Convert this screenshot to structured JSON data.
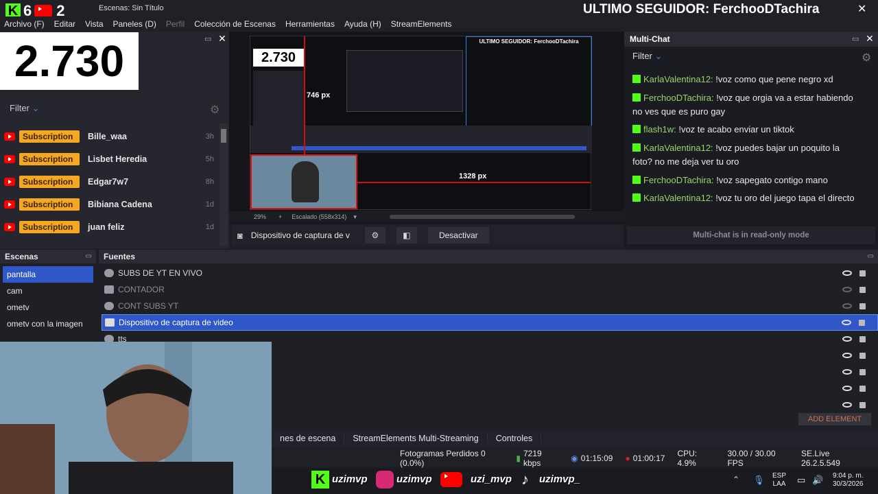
{
  "window": {
    "title": "Escenas: Sin Título",
    "follower_banner": "ULTIMO SEGUIDOR: FerchooDTachira",
    "overlay_k_count": "6",
    "overlay_yt_count": "2",
    "counter": "2.730"
  },
  "menu": [
    "Archivo (F)",
    "Editar",
    "Vista",
    "Paneles (D)",
    "Perfil",
    "Colección de Escenas",
    "Herramientas",
    "Ayuda (H)",
    "StreamElements"
  ],
  "feed": {
    "filter_label": "Filter",
    "items": [
      {
        "badge": "Subscription",
        "name": "Bille_waa",
        "time": "3h"
      },
      {
        "badge": "Subscription",
        "name": "Lisbet Heredia",
        "time": "5h"
      },
      {
        "badge": "Subscription",
        "name": "Edgar7w7",
        "time": "8h"
      },
      {
        "badge": "Subscription",
        "name": "Bibiana Cadena",
        "time": "1d"
      },
      {
        "badge": "Subscription",
        "name": "juan feliz",
        "time": "1d"
      }
    ]
  },
  "preview": {
    "inner_counter": "2.730",
    "inner_banner": "ULTIMO SEGUIDOR: FerchooDTachira",
    "measure_v": "746 px",
    "measure_h": "1328 px",
    "zoom": "29%",
    "scale_label": "Escalado (558x314)"
  },
  "source_toolbar": {
    "source_name": "Dispositivo de captura de v",
    "deactivate_label": "Desactivar"
  },
  "chat": {
    "title": "Multi-Chat",
    "filter_label": "Filter",
    "readonly_note": "Multi-chat is in read-only mode",
    "messages": [
      {
        "user": "KarlaValentina12:",
        "text": "!voz como que pene negro xd"
      },
      {
        "user": "FerchooDTachira:",
        "text": "!voz que orgia va a estar habiendo no ves que es puro gay"
      },
      {
        "user": "flash1w:",
        "text": "!voz te acabo enviar un tiktok"
      },
      {
        "user": "KarlaValentina12:",
        "text": "!voz puedes bajar un poquito la foto? no me deja ver tu oro"
      },
      {
        "user": "FerchooDTachira:",
        "text": "!voz sapegato contigo mano"
      },
      {
        "user": "KarlaValentina12:",
        "text": "!voz tu oro del juego tapa el directo"
      }
    ]
  },
  "scenes": {
    "title": "Escenas",
    "items": [
      "pantalla",
      "cam",
      "ometv",
      "ometv con la imagen"
    ],
    "selected": 0
  },
  "sources": {
    "title": "Fuentes",
    "items": [
      {
        "name": "SUBS DE YT EN VIVO",
        "dim": false
      },
      {
        "name": "CONTADOR",
        "dim": true
      },
      {
        "name": "CONT SUBS YT",
        "dim": true
      },
      {
        "name": "Dispositivo de captura de video",
        "dim": false
      },
      {
        "name": "tts",
        "dim": false
      }
    ],
    "selected": 3,
    "add_label": "ADD ELEMENT"
  },
  "tabs": [
    "nes de escena",
    "StreamElements Multi-Streaming",
    "Controles"
  ],
  "status": {
    "dropped": "Fotogramas Perdidos 0 (0.0%)",
    "kbps": "7219 kbps",
    "stream_time": "01:15:09",
    "rec_time": "01:00:17",
    "cpu": "CPU: 4.9%",
    "fps": "30.00 / 30.00 FPS",
    "version": "SE.Live 26.2.5.549"
  },
  "taskbar": {
    "kick_handle": "uzimvp",
    "ig_handle": "uzimvp",
    "yt_handle": "uzi_mvp",
    "tt_handle": "uzimvp_",
    "lang_top": "ESP",
    "lang_bottom": "LAA",
    "time": "9:04 p. m.",
    "date": "30/3/2026"
  },
  "colors": {
    "accent": "#2f57c8",
    "kick_green": "#53fc18",
    "sub_badge": "#f5a623",
    "chat_user": "#9ad36a"
  }
}
